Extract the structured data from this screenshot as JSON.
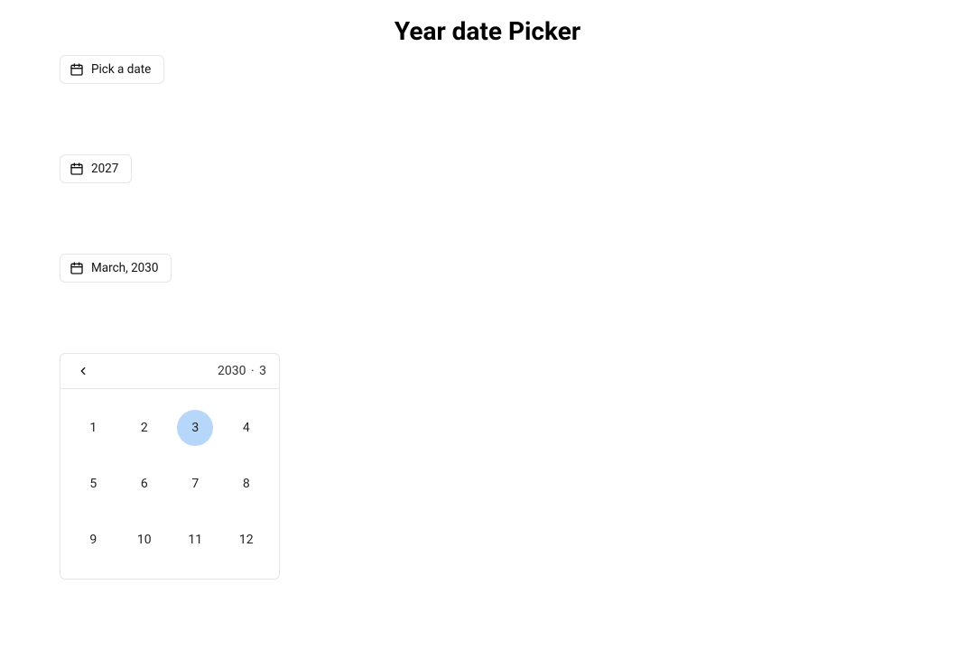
{
  "title": "Year date Picker",
  "inputs": {
    "placeholder": "Pick a date",
    "year_value": "2027",
    "month_value": "March, 2030"
  },
  "popup": {
    "header_year": "2030",
    "header_separator": "·",
    "header_month": "3",
    "selected_month": 3,
    "months": [
      "1",
      "2",
      "3",
      "4",
      "5",
      "6",
      "7",
      "8",
      "9",
      "10",
      "11",
      "12"
    ]
  }
}
